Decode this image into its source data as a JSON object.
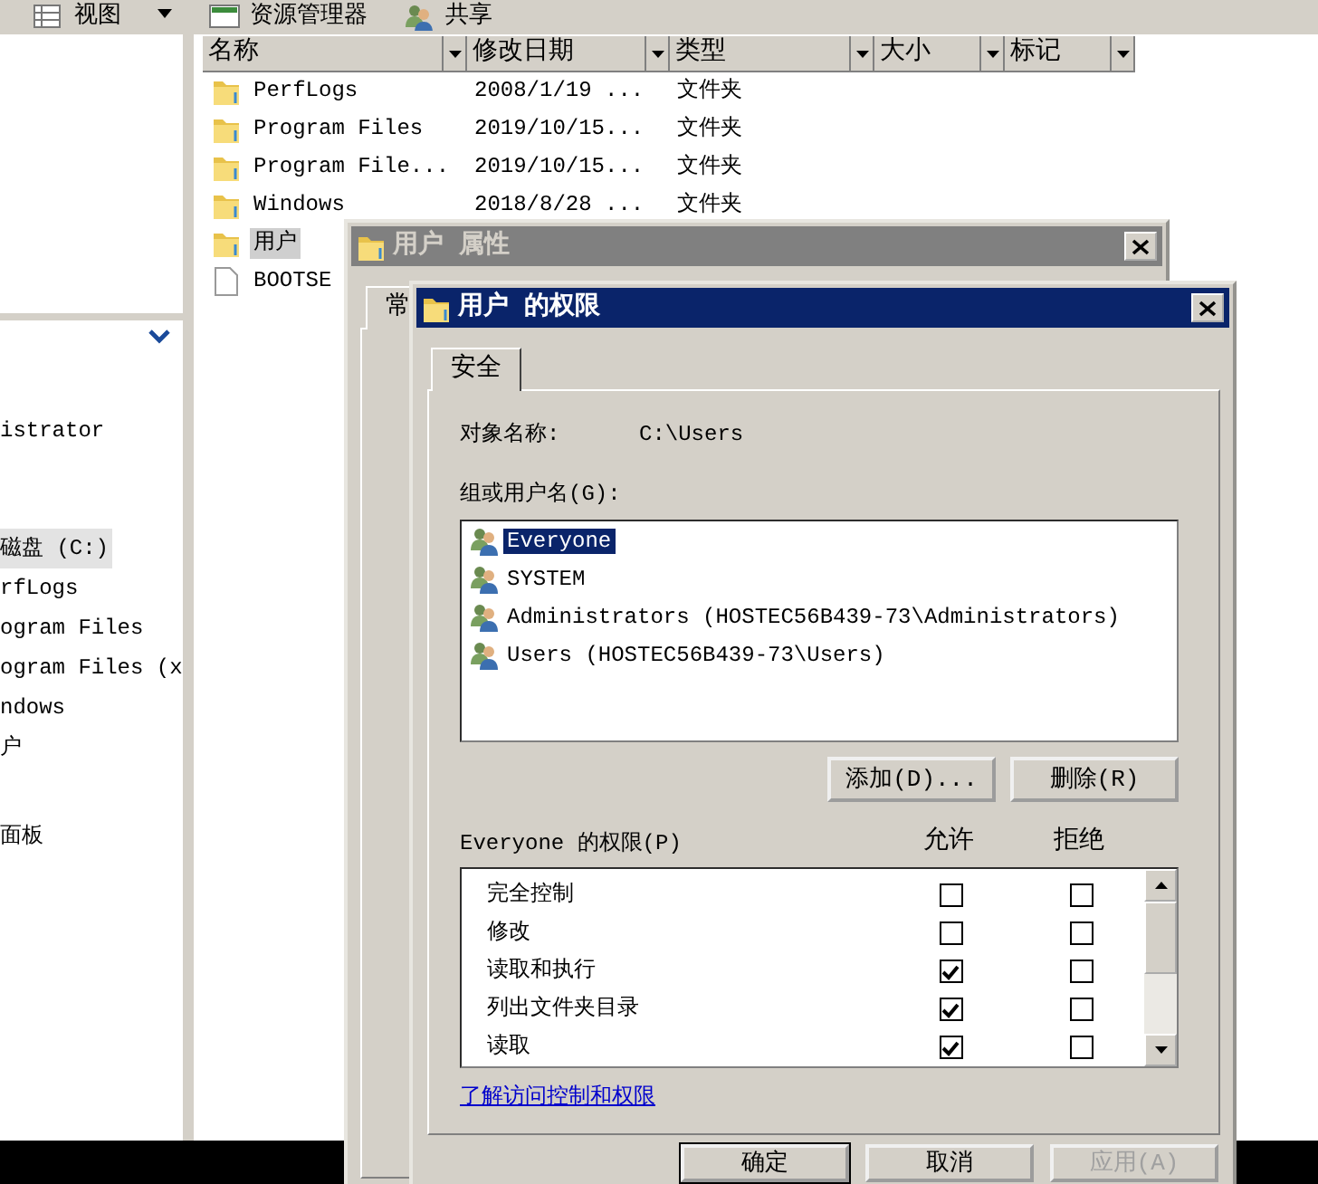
{
  "toolbar": [
    {
      "kind": "view",
      "label": "视图"
    },
    {
      "kind": "menu-arrow"
    },
    {
      "kind": "explorer",
      "label": "资源管理器"
    },
    {
      "kind": "share",
      "label": "共享"
    }
  ],
  "nav_pane": {
    "groups": [
      [
        {
          "label": "istrator",
          "selected": false
        }
      ],
      [
        {
          "label": "磁盘 (C:)",
          "selected": true
        },
        {
          "label": "rfLogs",
          "selected": false
        },
        {
          "label": "ogram Files",
          "selected": false
        },
        {
          "label": "ogram Files (x",
          "selected": false
        },
        {
          "label": "ndows",
          "selected": false
        },
        {
          "label": "户",
          "selected": false
        }
      ],
      [
        {
          "label": "面板",
          "selected": false
        }
      ]
    ]
  },
  "file_list": {
    "columns": [
      {
        "label": "名称"
      },
      {
        "label": "修改日期"
      },
      {
        "label": "类型"
      },
      {
        "label": "大小"
      },
      {
        "label": "标记"
      }
    ],
    "rows": [
      {
        "kind": "folder",
        "name": "PerfLogs",
        "date": "2008/1/19 ...",
        "type": "文件夹",
        "selected": false
      },
      {
        "kind": "folder",
        "name": "Program Files",
        "date": "2019/10/15...",
        "type": "文件夹",
        "selected": false
      },
      {
        "kind": "folder",
        "name": "Program File...",
        "date": "2019/10/15...",
        "type": "文件夹",
        "selected": false
      },
      {
        "kind": "folder",
        "name": "Windows",
        "date": "2018/8/28 ...",
        "type": "文件夹",
        "selected": false
      },
      {
        "kind": "folder",
        "name": "用户",
        "selected": true
      },
      {
        "kind": "file",
        "name": "BOOTSE",
        "selected": false
      }
    ]
  },
  "properties_dialog": {
    "title": "用户 属性",
    "active": false,
    "tabs": [
      {
        "label": "常",
        "selected": true
      }
    ]
  },
  "permissions_dialog": {
    "title": "用户 的权限",
    "active": true,
    "tabs": [
      {
        "label": "安全",
        "selected": true
      }
    ],
    "object_name_label": "对象名称:",
    "object_name": "C:\\Users",
    "group_label": "组或用户名(G):",
    "principals": [
      {
        "name": "Everyone",
        "selected": true
      },
      {
        "name": "SYSTEM",
        "selected": false
      },
      {
        "name": "Administrators (HOSTEC56B439-73\\Administrators)",
        "selected": false
      },
      {
        "name": "Users (HOSTEC56B439-73\\Users)",
        "selected": false
      }
    ],
    "add_button": "添加(D)...",
    "remove_button": "删除(R)",
    "permissions_label": "Everyone 的权限(P)",
    "allow_header": "允许",
    "deny_header": "拒绝",
    "permissions": [
      {
        "name": "完全控制",
        "allow": false,
        "deny": false
      },
      {
        "name": "修改",
        "allow": false,
        "deny": false
      },
      {
        "name": "读取和执行",
        "allow": true,
        "deny": false
      },
      {
        "name": "列出文件夹目录",
        "allow": true,
        "deny": false
      },
      {
        "name": "读取",
        "allow": true,
        "deny": false
      }
    ],
    "help_link": "了解访问控制和权限",
    "buttons": [
      {
        "label": "确定",
        "disabled": false,
        "default": true
      },
      {
        "label": "取消",
        "disabled": false,
        "default": false
      },
      {
        "label": "应用(A)",
        "disabled": true,
        "default": false
      }
    ]
  }
}
